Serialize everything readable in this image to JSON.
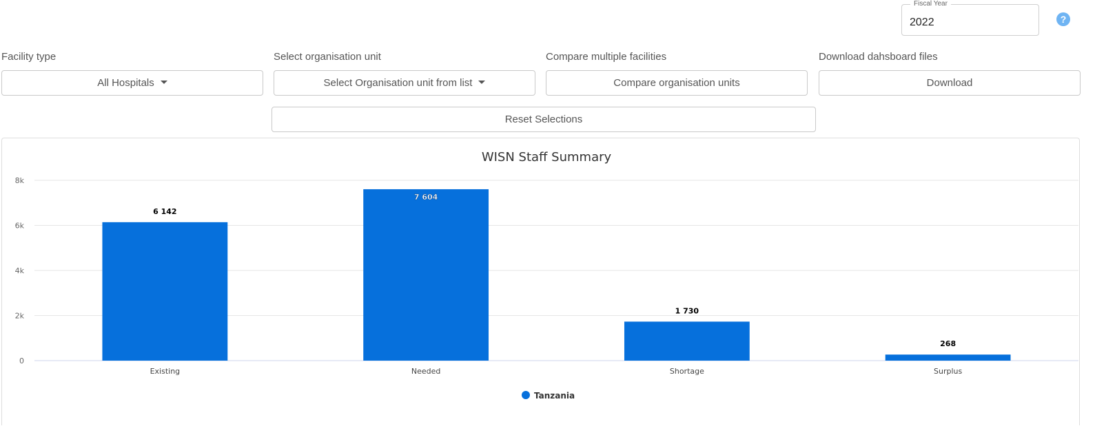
{
  "fiscal_year": {
    "label": "Fiscal Year",
    "value": "2022"
  },
  "help": {
    "icon": "question-circle-icon",
    "glyph": "?"
  },
  "controls": {
    "facility_type": {
      "label": "Facility type",
      "button": "All Hospitals"
    },
    "org_unit": {
      "label": "Select organisation unit",
      "button": "Select Organisation unit from list"
    },
    "compare": {
      "label": "Compare multiple facilities",
      "button": "Compare organisation units"
    },
    "download": {
      "label": "Download dahsboard files",
      "button": "Download"
    },
    "reset": {
      "button": "Reset Selections"
    }
  },
  "colors": {
    "bar": "#0670dc",
    "help": "#6fb4f3"
  },
  "chart_data": {
    "type": "bar",
    "title": "WISN Staff Summary",
    "categories": [
      "Existing",
      "Needed",
      "Shortage",
      "Surplus"
    ],
    "series": [
      {
        "name": "Tanzania",
        "values": [
          6142,
          7604,
          1730,
          268
        ],
        "labels": [
          "6 142",
          "7 604",
          "1 730",
          "268"
        ]
      }
    ],
    "ylim": [
      0,
      8000
    ],
    "yticks": [
      0,
      2000,
      4000,
      6000,
      8000
    ],
    "ytick_labels": [
      "0",
      "2k",
      "4k",
      "6k",
      "8k"
    ],
    "grid": true,
    "legend_position": "bottom-center"
  }
}
